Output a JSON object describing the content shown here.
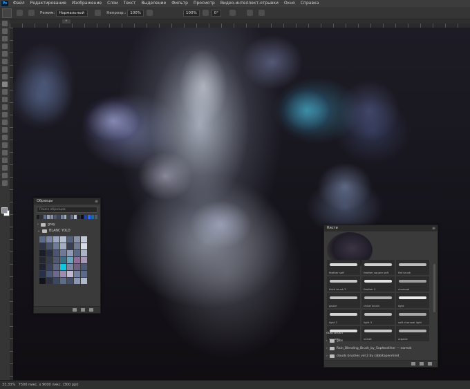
{
  "menu": {
    "app_logo": "Ps",
    "items": [
      "Файл",
      "Редактирование",
      "Изображение",
      "Слои",
      "Текст",
      "Выделение",
      "Фильтр",
      "Просмотр",
      "Видео-интеллект-отрывки",
      "Окно",
      "Справка"
    ]
  },
  "options": {
    "mode_label": "Режим:",
    "mode_value": "Нормальный",
    "opacity_label": "Непрозр.:",
    "opacity_value": "100%",
    "flow_value": "100%",
    "angle_value": "0°"
  },
  "document": {
    "tab_title": "×"
  },
  "status": {
    "zoom": "33,33%",
    "doc_info": "7500 пикс. x 9000 пикс. (300 ppi)"
  },
  "swatches_panel": {
    "title": "Образцы",
    "search_placeholder": "Поиск образцов",
    "recent": [
      "#1a1a1a",
      "#2a2f3d",
      "#5d6e8a",
      "#97a3b8",
      "#8a90a0",
      "#505a6e",
      "#3e4555",
      "#7581a0",
      "#9fb1c8",
      "#3a3f4b",
      "#606b84",
      "#b6c0d2",
      "#23262f",
      "#0e0f14",
      "#1c3fae",
      "#3366ff",
      "#1a6aa8",
      "#4a5b70"
    ],
    "groups": [
      {
        "name": "gray",
        "expanded": false
      },
      {
        "name": "BLANC YOLD",
        "expanded": true
      }
    ],
    "palette": [
      "#5b6a86",
      "#7a86a3",
      "#9aa6bf",
      "#b6c0d4",
      "#54607a",
      "#8891a8",
      "#c2c9d8",
      "#2e3445",
      "#47516a",
      "#6f7b96",
      "#a3adc2",
      "#3a3f52",
      "#707b92",
      "#d6dbe6",
      "#1a1d27",
      "#2a3142",
      "#4b5571",
      "#6d7a99",
      "#8e9ab6",
      "#5a6885",
      "#aab3c8",
      "#22262f",
      "#363b4a",
      "#50596e",
      "#3b6f86",
      "#6aa4bf",
      "#8c6d9a",
      "#a897b7",
      "#1d2230",
      "#3a4057",
      "#5c6681",
      "#11c7e0",
      "#7c87a6",
      "#6f6180",
      "#4f5a72",
      "#26304a",
      "#4c5778",
      "#6f6990",
      "#9e8bb0",
      "#c2b8cf",
      "#7480a0",
      "#5a6a8a",
      "#121419",
      "#2c3040",
      "#3a4862",
      "#5e6c88",
      "#45506a",
      "#8b97b2",
      "#b0b9cc"
    ]
  },
  "brushes_panel": {
    "title": "Кисти",
    "brushes": [
      {
        "name": "feather soft",
        "tone": "#d9d9d9"
      },
      {
        "name": "feather square soft",
        "tone": "#cfcfcf"
      },
      {
        "name": "flat brush",
        "tone": "#bcbcbc"
      },
      {
        "name": "thick brush 2",
        "tone": "#c8c8c8"
      },
      {
        "name": "feather 3",
        "tone": "#e2e2e2"
      },
      {
        "name": "charcoal",
        "tone": "#9e9e9e"
      },
      {
        "name": "gauze",
        "tone": "#c4c4c4"
      },
      {
        "name": "chisel brush",
        "tone": "#b4b4b4"
      },
      {
        "name": "light",
        "tone": "#eaeaea"
      },
      {
        "name": "light 2",
        "tone": "#d4d4d4"
      },
      {
        "name": "light 3",
        "tone": "#bfbfbf"
      },
      {
        "name": "soft charcoal light",
        "tone": "#a8a8a8"
      },
      {
        "name": "smooth",
        "tone": "#e0e0e0"
      },
      {
        "name": "velvet",
        "tone": "#c9c9c9"
      },
      {
        "name": "organic",
        "tone": "#b0b0b0"
      }
    ],
    "section_label": "dust brush",
    "folders": [
      "gibs",
      "Rain_Blending_Brush_by_Sophtseliher — normal",
      "clouds brushes vol 2 by rabbitopenmind"
    ]
  },
  "colors": {
    "menubar": "#3c3c3c",
    "panel": "#3a3a3a",
    "canvas_dark": "#15131a",
    "accent_blue": "#31a8ff"
  }
}
